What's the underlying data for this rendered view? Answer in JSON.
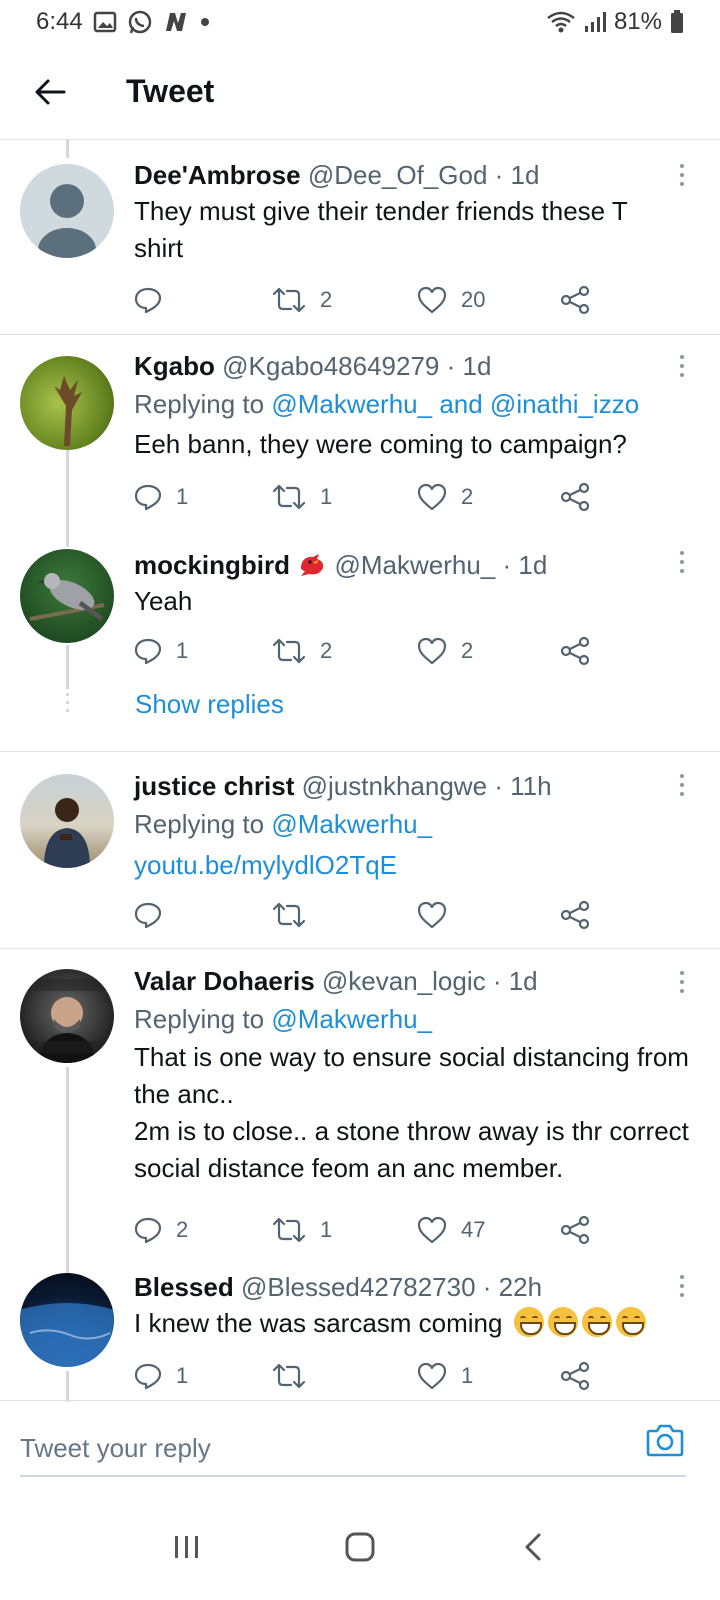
{
  "status_bar": {
    "time": "6:44",
    "battery": "81%",
    "icons": [
      "gallery-icon",
      "whatsapp-icon",
      "n-app-icon",
      "dot-icon",
      "wifi-icon",
      "signal-icon",
      "battery-icon"
    ]
  },
  "header": {
    "title": "Tweet",
    "back_icon": "arrow-left-icon"
  },
  "tweets": [
    {
      "name": "Dee'Ambrose",
      "handle": "@Dee_Of_God",
      "time": "· 1d",
      "text": "They must give their tender friends these T shirt",
      "replies": "",
      "retweets": "2",
      "likes": "20"
    },
    {
      "name": "Kgabo",
      "handle": "@Kgabo48649279",
      "time": "· 1d",
      "replying_prefix": "Replying to ",
      "replying_to": "@Makwerhu_ and @inathi_izzo",
      "text": "Eeh bann, they were coming to campaign?",
      "replies": "1",
      "retweets": "1",
      "likes": "2"
    },
    {
      "name": "mockingbird",
      "handle": "@Makwerhu_",
      "time": "· 1d",
      "text": "Yeah",
      "replies": "1",
      "retweets": "2",
      "likes": "2",
      "show_replies": "Show replies"
    },
    {
      "name": "justice christ",
      "handle": "@justnkhangwe",
      "time": "· 11h",
      "replying_prefix": "Replying to ",
      "replying_to": "@Makwerhu_",
      "link": "youtu.be/mylydlO2TqE",
      "replies": "",
      "retweets": "",
      "likes": ""
    },
    {
      "name": "Valar Dohaeris",
      "handle": "@kevan_logic",
      "time": "· 1d",
      "replying_prefix": "Replying to ",
      "replying_to": "@Makwerhu_",
      "text": "That is one way to ensure social distancing from the anc..",
      "text2": "2m is to close.. a stone throw away is thr correct social distance feom an anc member.",
      "replies": "2",
      "retweets": "1",
      "likes": "47"
    },
    {
      "name": "Blessed",
      "handle": "@Blessed42782730",
      "time": "· 22h",
      "text": "I knew the was sarcasm coming",
      "replies": "1",
      "retweets": "",
      "likes": "1"
    }
  ],
  "composer": {
    "placeholder": "Tweet your reply",
    "camera_icon": "camera-icon"
  },
  "nav": {
    "icons": [
      "recents-icon",
      "home-icon",
      "back-icon"
    ]
  },
  "colors": {
    "link": "#1e8ed8",
    "text": "#0f1419",
    "muted": "#536471",
    "divider": "#dfe3e6"
  }
}
